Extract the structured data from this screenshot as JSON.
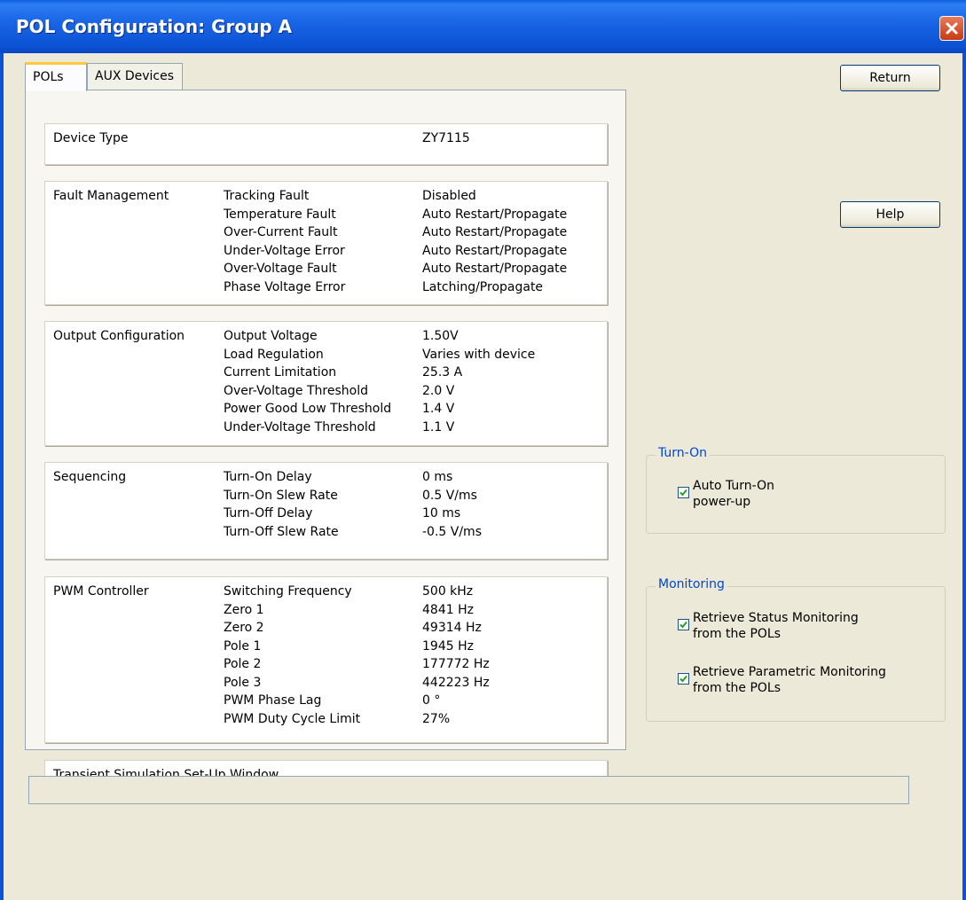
{
  "window": {
    "title": "POL Configuration: Group A"
  },
  "tabs": [
    {
      "label": "POLs",
      "active": true
    },
    {
      "label": "AUX Devices",
      "active": false
    }
  ],
  "buttons": {
    "return": "Return",
    "help": "Help"
  },
  "device": {
    "title": "Device Type",
    "value": "ZY7115"
  },
  "fault": {
    "title": "Fault Management",
    "rows": [
      {
        "label": "Tracking Fault",
        "value": "Disabled"
      },
      {
        "label": "Temperature Fault",
        "value": "Auto Restart/Propagate"
      },
      {
        "label": "Over-Current Fault",
        "value": "Auto Restart/Propagate"
      },
      {
        "label": "Under-Voltage Error",
        "value": "Auto Restart/Propagate"
      },
      {
        "label": "Over-Voltage Fault",
        "value": "Auto Restart/Propagate"
      },
      {
        "label": "Phase Voltage Error",
        "value": "Latching/Propagate"
      }
    ]
  },
  "output": {
    "title": "Output Configuration",
    "rows": [
      {
        "label": "Output Voltage",
        "value": "1.50V"
      },
      {
        "label": "Load Regulation",
        "value": "Varies with device"
      },
      {
        "label": "Current Limitation",
        "value": "25.3 A"
      },
      {
        "label": "Over-Voltage Threshold",
        "value": "2.0 V"
      },
      {
        "label": "Power Good Low Threshold",
        "value": "1.4 V"
      },
      {
        "label": "Under-Voltage Threshold",
        "value": "1.1 V"
      }
    ]
  },
  "sequencing": {
    "title": "Sequencing",
    "rows": [
      {
        "label": "Turn-On Delay",
        "value": "0 ms"
      },
      {
        "label": "Turn-On Slew Rate",
        "value": "0.5 V/ms"
      },
      {
        "label": "Turn-Off Delay",
        "value": "10 ms"
      },
      {
        "label": "Turn-Off Slew Rate",
        "value": "-0.5 V/ms"
      }
    ]
  },
  "pwm": {
    "title": "PWM Controller",
    "rows": [
      {
        "label": "Switching Frequency",
        "value": "500 kHz"
      },
      {
        "label": "Zero 1",
        "value": "4841 Hz"
      },
      {
        "label": "Zero 2",
        "value": "49314 Hz"
      },
      {
        "label": "Pole 1",
        "value": "1945 Hz"
      },
      {
        "label": "Pole 2",
        "value": "177772 Hz"
      },
      {
        "label": "Pole 3",
        "value": "442223 Hz"
      },
      {
        "label": "PWM Phase Lag",
        "value": "0 °"
      },
      {
        "label": "PWM Duty Cycle Limit",
        "value": "27%"
      }
    ]
  },
  "transient": {
    "title": "Transient Simulation Set-Up Window"
  },
  "turn_on": {
    "label": "Turn-On",
    "auto_turn_on": {
      "label": "Auto Turn-On\npower-up",
      "checked": true
    }
  },
  "monitoring": {
    "label": "Monitoring",
    "status": {
      "label": "Retrieve Status Monitoring\nfrom the POLs",
      "checked": true
    },
    "parametric": {
      "label": "Retrieve Parametric Monitoring\nfrom the POLs",
      "checked": true
    }
  },
  "colors": {
    "title_bar": "#0b53d6",
    "group_label": "#0046d5",
    "check_mark": "#21a121",
    "tab_highlight": "#ffc83c"
  }
}
